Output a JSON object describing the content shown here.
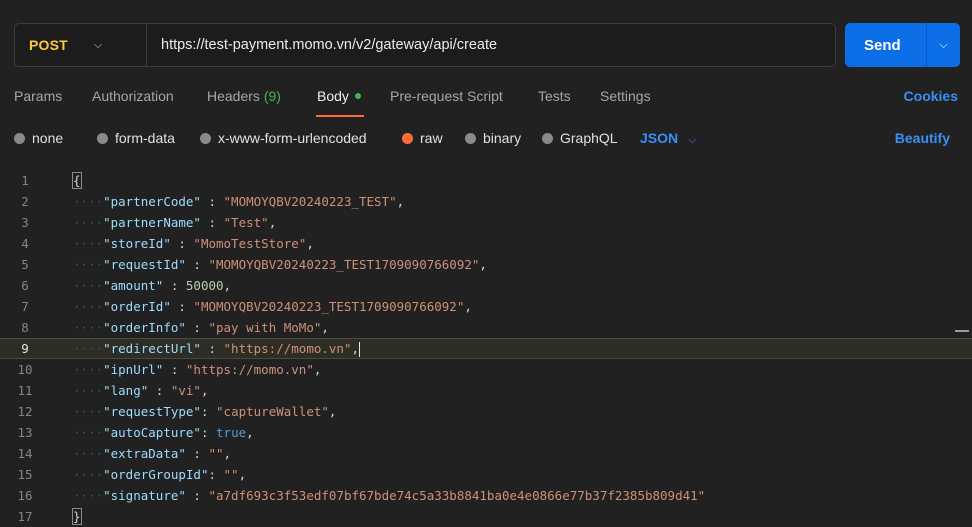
{
  "request": {
    "method": "POST",
    "url": "https://test-payment.momo.vn/v2/gateway/api/create",
    "send_label": "Send"
  },
  "tabs": {
    "params": "Params",
    "authorization": "Authorization",
    "headers": "Headers",
    "headers_count": "(9)",
    "body": "Body",
    "pre_request": "Pre-request Script",
    "tests": "Tests",
    "settings": "Settings",
    "cookies": "Cookies"
  },
  "body_types": {
    "none": "none",
    "form_data": "form-data",
    "urlencoded": "x-www-form-urlencoded",
    "raw": "raw",
    "binary": "binary",
    "graphql": "GraphQL",
    "format": "JSON",
    "beautify": "Beautify"
  },
  "colors": {
    "accent": "#0c6ee6",
    "method": "#ffc83d",
    "active_tab_underline": "#ff6c37",
    "link": "#3a8ef6",
    "status_dot": "#3fb950"
  },
  "editor": {
    "current_line": 9,
    "lines": [
      {
        "n": "1",
        "t": "open"
      },
      {
        "n": "2",
        "key": "partnerCode",
        "sep": " : ",
        "val": "\"MOMOYQBV20240223_TEST\"",
        "vt": "str",
        "end": ","
      },
      {
        "n": "3",
        "key": "partnerName",
        "sep": " : ",
        "val": "\"Test\"",
        "vt": "str",
        "end": ","
      },
      {
        "n": "4",
        "key": "storeId",
        "sep": " : ",
        "val": "\"MomoTestStore\"",
        "vt": "str",
        "end": ","
      },
      {
        "n": "5",
        "key": "requestId",
        "sep": " : ",
        "val": "\"MOMOYQBV20240223_TEST1709090766092\"",
        "vt": "str",
        "end": ","
      },
      {
        "n": "6",
        "key": "amount",
        "sep": " : ",
        "val": "50000",
        "vt": "num",
        "end": ","
      },
      {
        "n": "7",
        "key": "orderId",
        "sep": " : ",
        "val": "\"MOMOYQBV20240223_TEST1709090766092\"",
        "vt": "str",
        "end": ","
      },
      {
        "n": "8",
        "key": "orderInfo",
        "sep": " : ",
        "val": "\"pay with MoMo\"",
        "vt": "str",
        "end": ","
      },
      {
        "n": "9",
        "key": "redirectUrl",
        "sep": " : ",
        "val": "\"https://momo.vn\"",
        "vt": "str",
        "end": ","
      },
      {
        "n": "10",
        "key": "ipnUrl",
        "sep": " : ",
        "val": "\"https://momo.vn\"",
        "vt": "str",
        "end": ","
      },
      {
        "n": "11",
        "key": "lang",
        "sep": " : ",
        "val": "\"vi\"",
        "vt": "str",
        "end": ","
      },
      {
        "n": "12",
        "key": "requestType",
        "sep": ": ",
        "val": "\"captureWallet\"",
        "vt": "str",
        "end": ","
      },
      {
        "n": "13",
        "key": "autoCapture",
        "sep": ": ",
        "val": "true",
        "vt": "bool",
        "end": ","
      },
      {
        "n": "14",
        "key": "extraData",
        "sep": " : ",
        "val": "\"\"",
        "vt": "str",
        "end": ","
      },
      {
        "n": "15",
        "key": "orderGroupId",
        "sep": ": ",
        "val": "\"\"",
        "vt": "str",
        "end": ","
      },
      {
        "n": "16",
        "key": "signature",
        "sep": " : ",
        "val": "\"a7df693c3f53edf07bf67bde74c5a33b8841ba0e4e0866e77b37f2385b809d41\"",
        "vt": "str",
        "end": ""
      },
      {
        "n": "17",
        "t": "close"
      }
    ]
  }
}
